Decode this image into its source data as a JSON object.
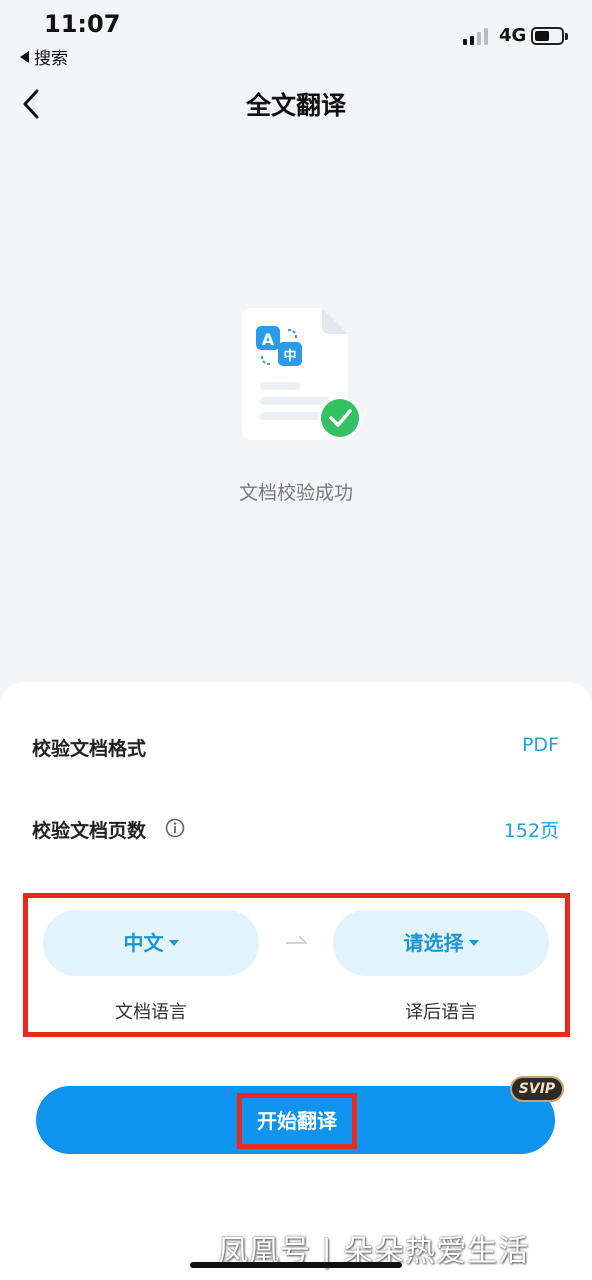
{
  "status_bar": {
    "time": "11:07",
    "back_app_label": "搜索",
    "network": "4G",
    "battery_level": 0.45
  },
  "nav": {
    "title": "全文翻译"
  },
  "document": {
    "status_text": "文档校验成功",
    "icon_glyph_a": "A",
    "icon_glyph_zh": "中"
  },
  "check": {
    "format_label": "校验文档格式",
    "format_value": "PDF",
    "pages_label": "校验文档页数",
    "pages_value": "152页"
  },
  "language": {
    "source_value": "中文",
    "source_caption": "文档语言",
    "target_value": "请选择",
    "target_caption": "译后语言"
  },
  "action": {
    "start_label": "开始翻译",
    "badge": "SVIP"
  },
  "watermark": "凤凰号 | 朵朵热爱生活",
  "colors": {
    "accent": "#1b97d6",
    "button": "#0e94ee",
    "highlight_frame": "#e8291c",
    "success": "#34c163"
  }
}
